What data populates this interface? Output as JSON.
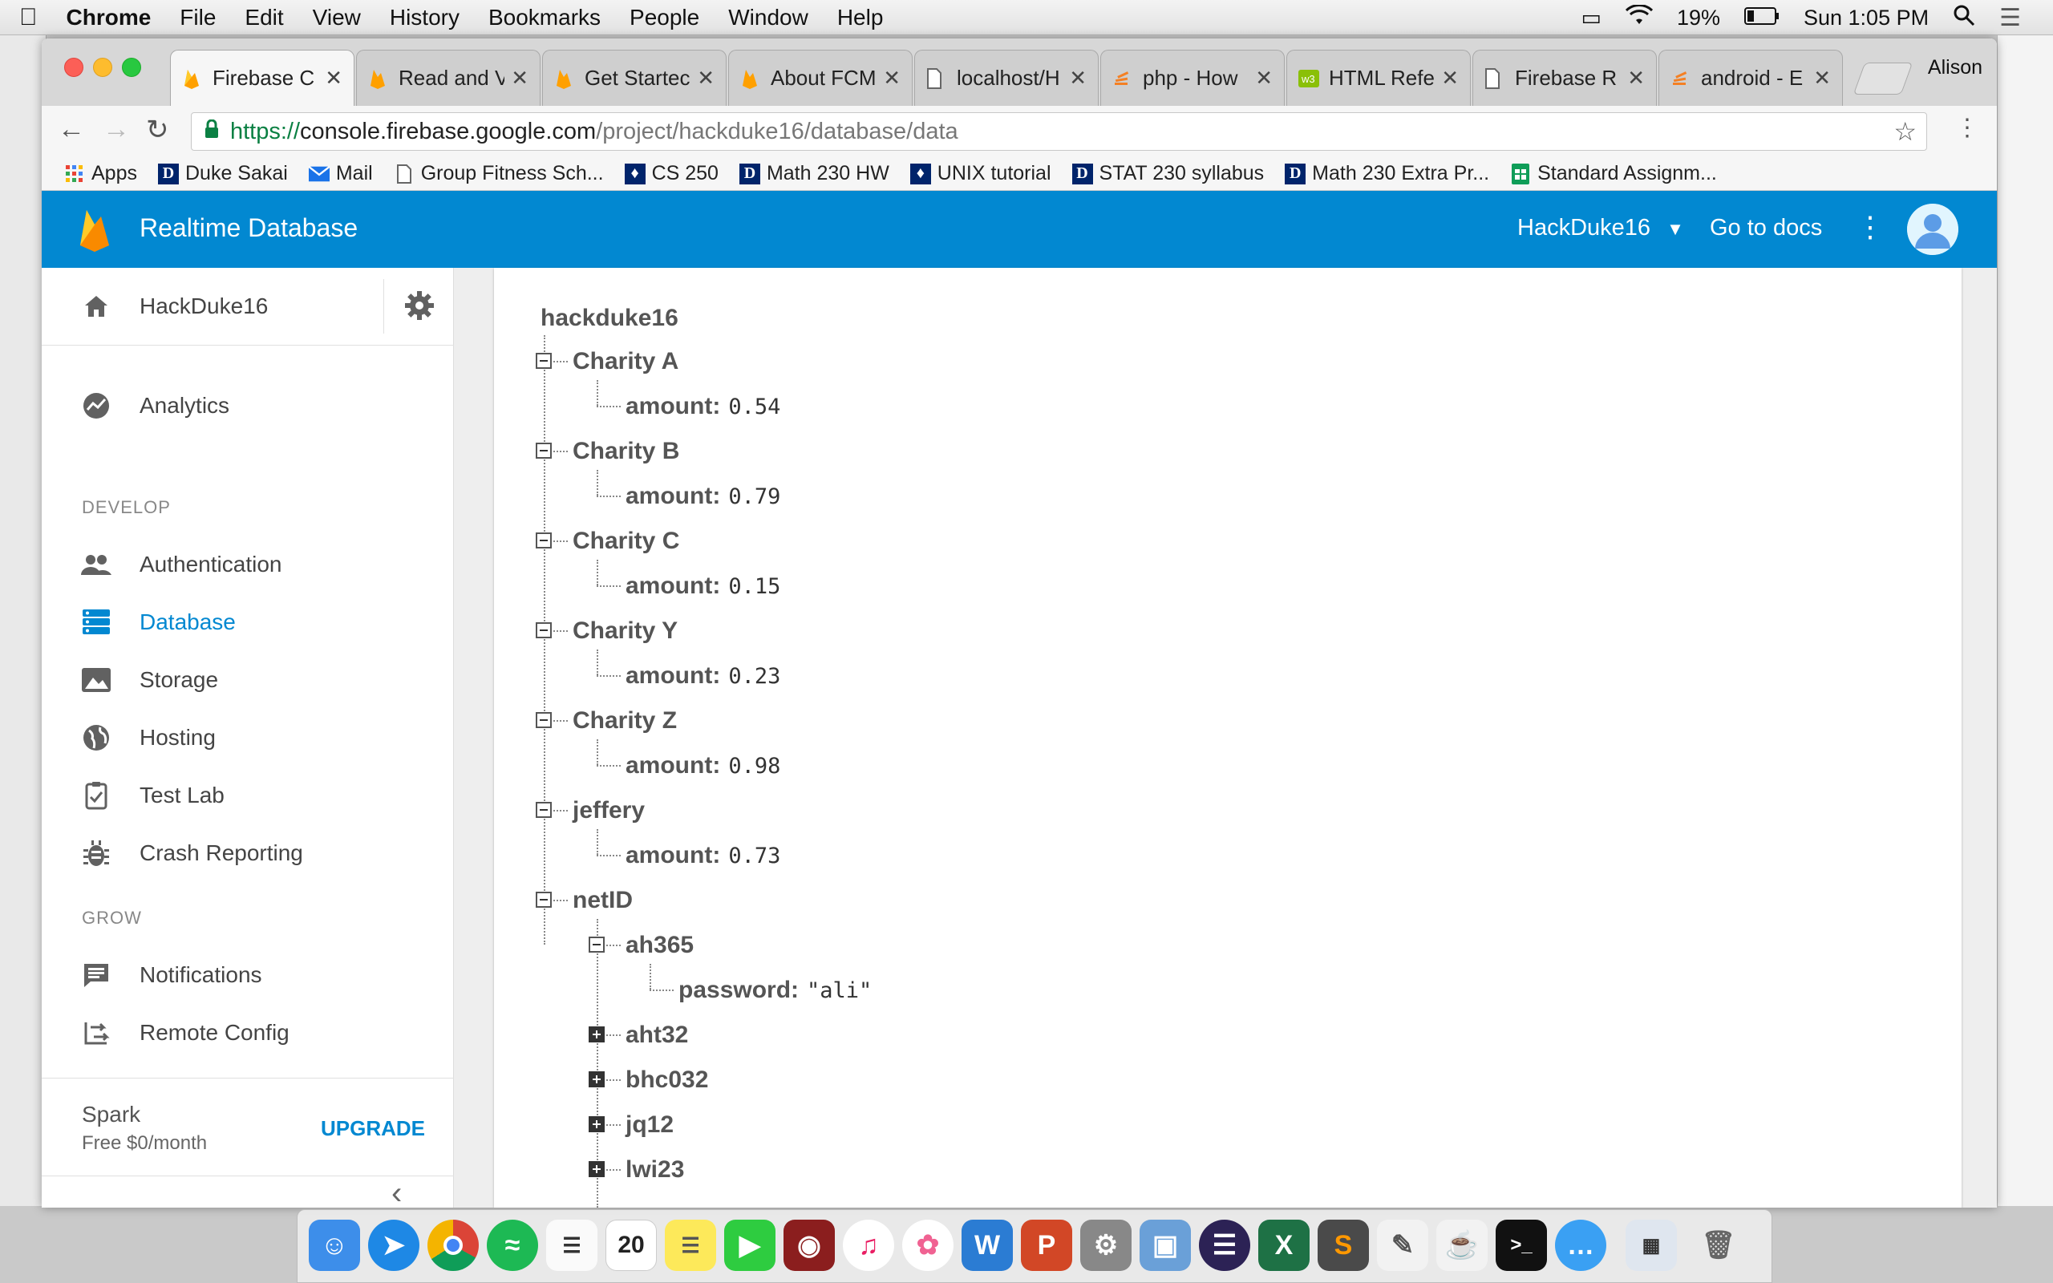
{
  "menubar": {
    "app": "Chrome",
    "items": [
      "File",
      "Edit",
      "View",
      "History",
      "Bookmarks",
      "People",
      "Window",
      "Help"
    ],
    "battery": "19%",
    "clock": "Sun 1:05 PM"
  },
  "window": {
    "profile": "Alison",
    "tabs": [
      {
        "title": "Firebase C"
      },
      {
        "title": "Read and V"
      },
      {
        "title": "Get Startec"
      },
      {
        "title": "About FCM"
      },
      {
        "title": "localhost/H"
      },
      {
        "title": "php - How"
      },
      {
        "title": "HTML Refe"
      },
      {
        "title": "Firebase R"
      },
      {
        "title": "android - E"
      }
    ],
    "url": {
      "scheme": "https://",
      "host": "console.firebase.google.com",
      "path": "/project/hackduke16/database/data"
    },
    "bookmarks": [
      "Apps",
      "Duke Sakai",
      "Mail",
      "Group Fitness Sch...",
      "CS 250",
      "Math 230 HW",
      "UNIX tutorial",
      "STAT 230 syllabus",
      "Math 230 Extra Pr...",
      "Standard Assignm..."
    ]
  },
  "header": {
    "title": "Realtime Database",
    "project": "HackDuke16",
    "docs": "Go to docs"
  },
  "sidebar": {
    "project_home": "HackDuke16",
    "analytics": "Analytics",
    "develop_label": "DEVELOP",
    "develop": [
      "Authentication",
      "Database",
      "Storage",
      "Hosting",
      "Test Lab",
      "Crash Reporting"
    ],
    "grow_label": "GROW",
    "grow": [
      "Notifications",
      "Remote Config"
    ],
    "plan": {
      "name": "Spark",
      "price": "Free $0/month",
      "upgrade": "UPGRADE"
    }
  },
  "tree": {
    "root": "hackduke16",
    "charities": [
      {
        "name": "Charity A",
        "key": "amount:",
        "value": "0.54"
      },
      {
        "name": "Charity B",
        "key": "amount:",
        "value": "0.79"
      },
      {
        "name": "Charity C",
        "key": "amount:",
        "value": "0.15"
      },
      {
        "name": "Charity Y",
        "key": "amount:",
        "value": "0.23"
      },
      {
        "name": "Charity Z",
        "key": "amount:",
        "value": "0.98"
      },
      {
        "name": "jeffery",
        "key": "amount:",
        "value": "0.73"
      }
    ],
    "netid": {
      "name": "netID",
      "expanded": {
        "name": "ah365",
        "key": "password:",
        "value": "\"ali\""
      },
      "collapsed": [
        "aht32",
        "bhc032",
        "jq12",
        "lwi23"
      ]
    }
  },
  "colors": {
    "accent": "#0288d1",
    "firebase_orange": "#ffa000"
  }
}
